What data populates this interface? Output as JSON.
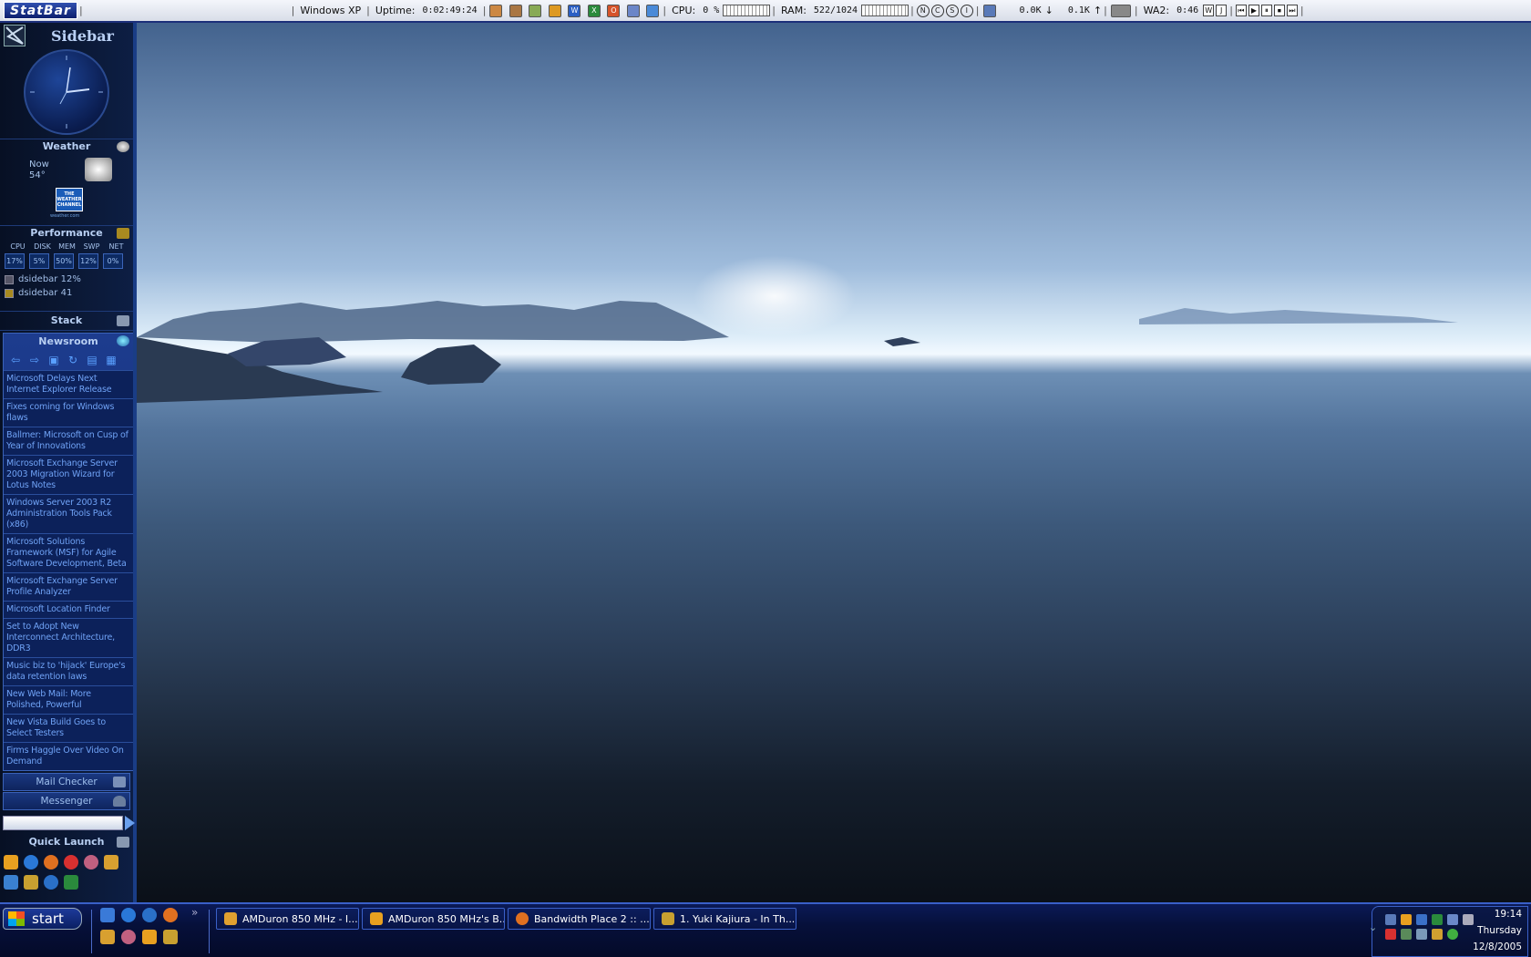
{
  "statbar": {
    "logo": "StatBar",
    "os": "Windows XP",
    "uptime_label": "Uptime:",
    "uptime_value": "0:02:49:24",
    "cpu_label": "CPU:",
    "cpu_value": "0 %",
    "ram_label": "RAM:",
    "ram_value": "522/1024",
    "circles": [
      "N",
      "C",
      "S",
      "I"
    ],
    "net_down": "0.0K",
    "net_up": "0.1K",
    "wa2_label": "WA2:",
    "wa2_value": "0:46",
    "wa_buttons": [
      "W",
      "J",
      "⏮",
      "▶",
      "⏸",
      "⏹",
      "⏭"
    ]
  },
  "sidebar": {
    "title": "Sidebar",
    "weather": {
      "title": "Weather",
      "now_label": "Now",
      "temp": "54°",
      "twc_label": "THE WEATHER CHANNEL",
      "twc_sub": "weather.com"
    },
    "performance": {
      "title": "Performance",
      "labels": [
        "CPU",
        "DISK",
        "MEM",
        "SWP",
        "NET"
      ],
      "values": [
        "17%",
        "5%",
        "50%",
        "12%",
        "0%"
      ],
      "procs": [
        "dsidebar 12%",
        "dsidebar 41"
      ]
    },
    "stack": {
      "title": "Stack"
    },
    "newsroom": {
      "title": "Newsroom",
      "items": [
        "Microsoft Delays Next Internet Explorer Release",
        "Fixes coming for Windows flaws",
        "Ballmer: Microsoft on Cusp of Year of Innovations",
        "Microsoft Exchange Server 2003 Migration Wizard for Lotus Notes",
        "Windows Server 2003 R2 Administration Tools Pack (x86)",
        "Microsoft Solutions Framework (MSF) for Agile Software Development, Beta",
        "Microsoft Exchange Server Profile Analyzer",
        "Microsoft Location Finder",
        "Set to Adopt New Interconnect Architecture, DDR3",
        "Music biz to 'hijack' Europe's data retention laws",
        "New Web Mail: More Polished, Powerful",
        "New Vista Build Goes to Select Testers",
        "Firms Haggle Over Video On Demand"
      ]
    },
    "mail_checker": "Mail Checker",
    "messenger": "Messenger",
    "search_value": "",
    "quick_launch": "Quick Launch"
  },
  "taskbar": {
    "start": "start",
    "more": "»",
    "buttons": [
      "AMDuron 850 MHz - I...",
      "AMDuron 850 MHz's B...",
      "Bandwidth Place 2 :: ...",
      "1. Yuki Kajiura - In Th..."
    ],
    "clock": {
      "time": "19:14",
      "day": "Thursday",
      "date": "12/8/2005"
    }
  },
  "colors": {
    "accent": "#1c2f7a",
    "link": "#6fa2f5",
    "sidebar_bg": "#0b1936"
  }
}
